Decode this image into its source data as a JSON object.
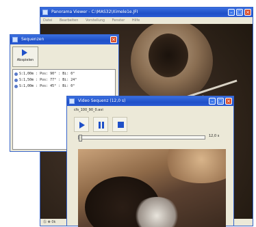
{
  "panorama_viewer": {
    "title": "Panorama Viewer - C:\\MAS32\\Ximele1e.JFI",
    "menu": [
      "Datei",
      "Bearbeiten",
      "Vorstellung",
      "Fenster",
      "Hilfe"
    ],
    "status": "Ⓢ ✥ 0k"
  },
  "sequenzen": {
    "title": "Sequenzen",
    "play_label": "Abspielen",
    "items": [
      "S:1,00m : Pos: 90° : Bi: 0°",
      "S:1,50m : Pos: 77° : Bi: 24°",
      "S:1,00m : Pos: 45° : Bi: 0°"
    ]
  },
  "video_sequence": {
    "title": "Video Sequenz (12,0 s)",
    "filename": "cfs_100_90_0.avi",
    "time": "12,0 s",
    "progress": 0.0
  },
  "colors": {
    "titlebar": "#1f50c8",
    "close": "#d9502d",
    "accent_blue": "#1f50c8"
  }
}
